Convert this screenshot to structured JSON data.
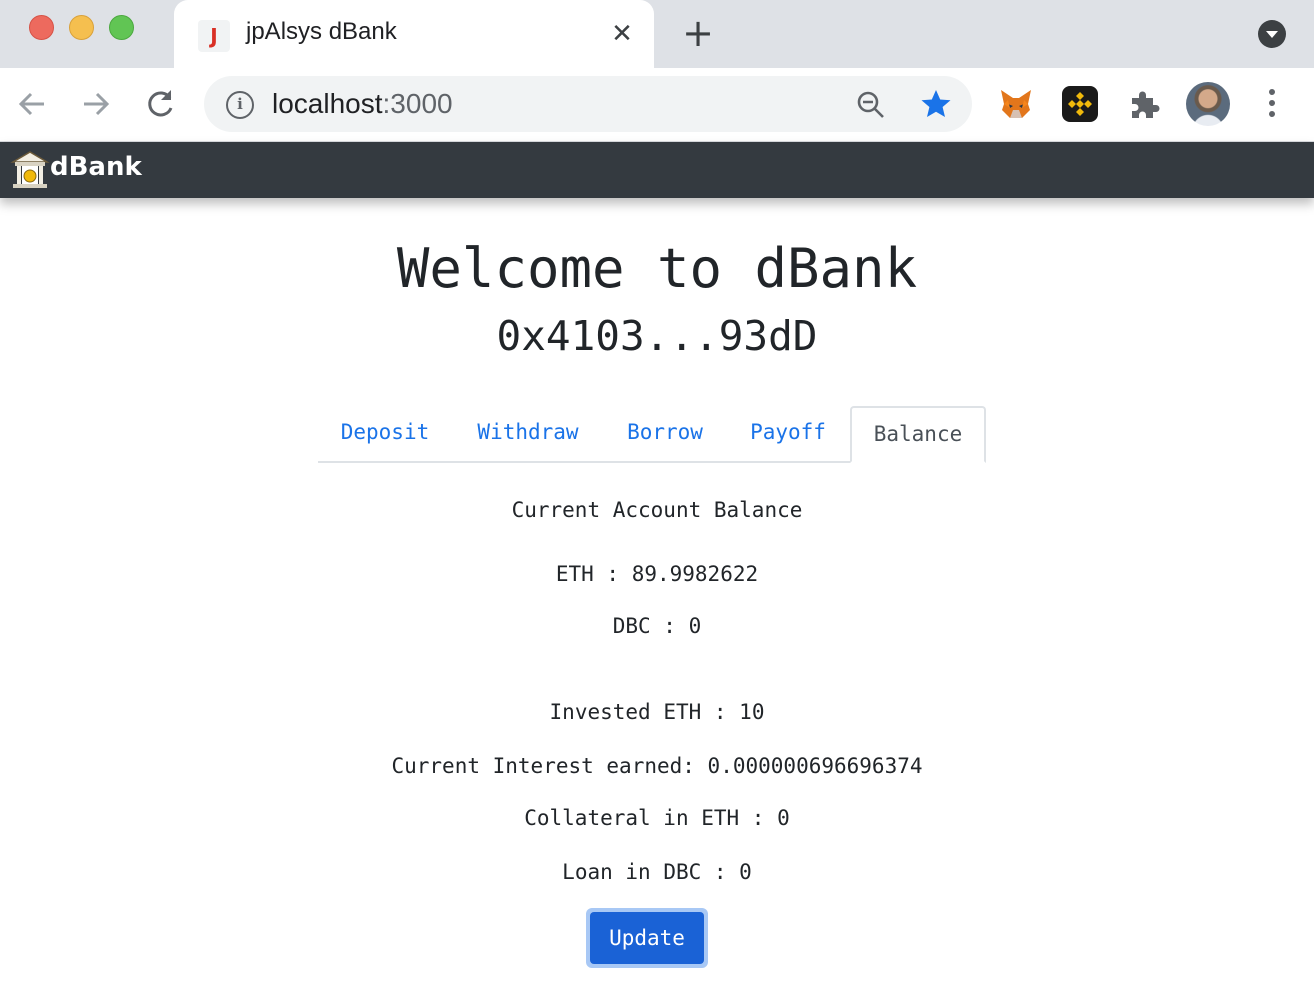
{
  "browser": {
    "tab_title": "jpAlsys dBank",
    "tab_favicon": "J",
    "url_host": "localhost",
    "url_port": ":3000"
  },
  "navbar": {
    "brand": "dBank"
  },
  "main": {
    "welcome": "Welcome to dBank",
    "account": "0x4103...93dD",
    "tabs": [
      {
        "label": "Deposit"
      },
      {
        "label": "Withdraw"
      },
      {
        "label": "Borrow"
      },
      {
        "label": "Payoff"
      },
      {
        "label": "Balance"
      }
    ],
    "balance": {
      "heading": "Current Account Balance",
      "eth": "ETH : 89.9982622",
      "dbc": "DBC : 0",
      "invested": "Invested ETH : 10",
      "interest": "Current Interest earned: 0.000000696696374",
      "collateral": "Collateral in ETH : 0",
      "loan": "Loan in DBC : 0",
      "update_label": "Update"
    }
  },
  "colors": {
    "navbar_bg": "#343a40",
    "tab_link": "#1a73e8",
    "button_primary": "#1a62d6"
  }
}
